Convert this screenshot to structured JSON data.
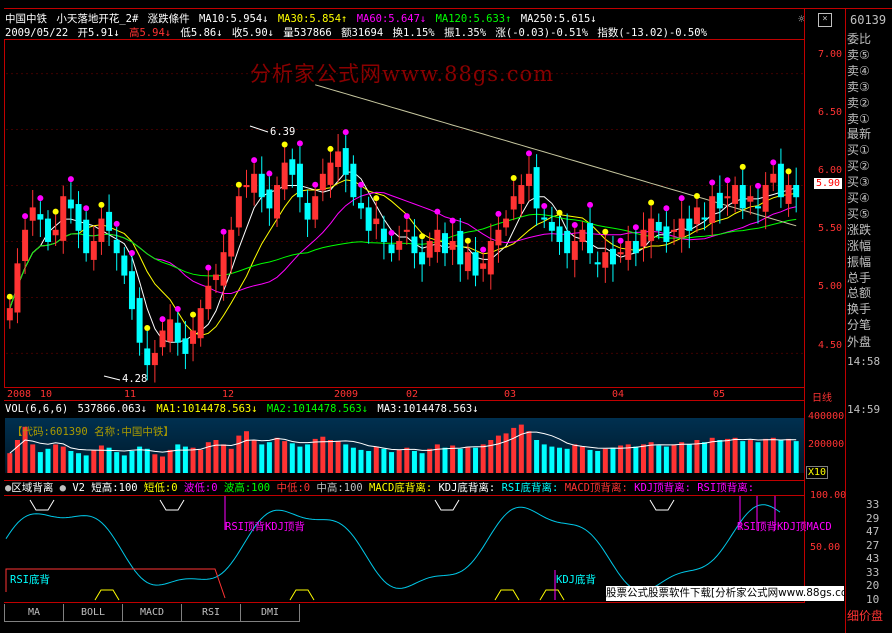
{
  "header": {
    "stock_name": "中国中铁",
    "indicator_name": "小天落地开花_2#",
    "condition": "涨跌條件",
    "ma10": "MA10:5.954↓",
    "ma30": "MA30:5.854↑",
    "ma60": "MA60:5.647↓",
    "ma120": "MA120:5.633↑",
    "ma250": "MA250:5.615↓",
    "date": "2009/05/22",
    "open": "开5.91↓",
    "high": "高5.94↓",
    "low": "低5.86↓",
    "close": "收5.90↓",
    "volume": "量537866",
    "amount": "额31694",
    "turnover": "换1.15%",
    "amplitude": "振1.35%",
    "change": "涨(-0.03)-0.51%",
    "index": "指数(-13.02)-0.50%"
  },
  "watermark": "分析家公式网www.88gs.com",
  "price_axis": [
    "7.00",
    "6.50",
    "6.00",
    "5.50",
    "5.00",
    "4.50"
  ],
  "current_price_badge": "5.90",
  "annot_high": "6.39",
  "annot_low": "4.28",
  "date_axis": [
    "2008",
    "10",
    "11",
    "12",
    "2009",
    "02",
    "03",
    "04",
    "05"
  ],
  "date_axis_right": "日线",
  "volume_header": {
    "vol": "VOL(6,6,6)",
    "value": "537866.063↓",
    "ma1": "MA1:1014478.563↓",
    "ma2": "MA2:1014478.563↓",
    "ma3": "MA3:1014478.563↓"
  },
  "volume_code_label": "【代码:601390 名称:中国中铁】",
  "volume_axis": [
    "400000",
    "200000"
  ],
  "volume_unit": "X10",
  "indicator_header": {
    "name": "区域背离",
    "v2": "V2",
    "items": [
      {
        "text": "短高:100",
        "color": "#ffffff"
      },
      {
        "text": "短低:0",
        "color": "#ffff00"
      },
      {
        "text": "波低:0",
        "color": "#ff00ff"
      },
      {
        "text": "波高:100",
        "color": "#00ff00"
      },
      {
        "text": "中低:0",
        "color": "#ff3333"
      },
      {
        "text": "中高:100",
        "color": "#c0c0c0"
      },
      {
        "text": "MACD底背离:",
        "color": "#ffff00"
      },
      {
        "text": "KDJ底背离:",
        "color": "#ffffff"
      },
      {
        "text": "RSI底背离:",
        "color": "#00ffff"
      },
      {
        "text": "MACD顶背离:",
        "color": "#ff3333"
      },
      {
        "text": "KDJ顶背离:",
        "color": "#ff00ff"
      },
      {
        "text": "RSI顶背离:",
        "color": "#ff00ff"
      }
    ]
  },
  "indicator_axis": [
    "100.00",
    "50.00"
  ],
  "indicator_labels": {
    "rsi_top": "RSI顶背",
    "kdj_top": "KDJ顶背",
    "rsi_bottom": "RSI底背",
    "kdj_bottom": "KDJ底背",
    "rsi_top2": "RSI顶背",
    "kdj_top2": "KDJ顶",
    "macd_top2": "MACD"
  },
  "tabs": [
    "MA",
    "BOLL",
    "MACD",
    "RSI",
    "DMI"
  ],
  "ad_text": "股票公式股票软件下载[分析家公式网www.88gs.com]",
  "sidebar": {
    "code": "60139",
    "rows": [
      "委比",
      "卖⑤",
      "卖④",
      "卖③",
      "卖②",
      "卖①",
      "最新",
      "买①",
      "买②",
      "买③",
      "买④",
      "买⑤",
      "涨跌",
      "涨幅",
      "振幅",
      "总手",
      "总额",
      "换手",
      "分笔"
    ],
    "outer": "外盘",
    "times": [
      "14:58",
      "14:59"
    ],
    "numbers": [
      "33",
      "29",
      "47",
      "27",
      "43",
      "33",
      "20",
      "10"
    ],
    "detail": "细价盘"
  },
  "chart_data": {
    "type": "candlestick",
    "title": "中国中铁",
    "ylim": [
      4.2,
      7.3
    ],
    "y_ticks": [
      4.5,
      5.0,
      5.5,
      6.0,
      6.5,
      7.0
    ],
    "x_labels": [
      "2008",
      "10",
      "11",
      "12",
      "2009",
      "02",
      "03",
      "04",
      "05"
    ],
    "annotations": [
      {
        "label": "6.39",
        "value": 6.39
      },
      {
        "label": "4.28",
        "value": 4.28
      }
    ],
    "last_close": 5.9,
    "closes": [
      4.9,
      5.3,
      5.6,
      5.8,
      5.7,
      5.5,
      5.6,
      5.9,
      5.8,
      5.6,
      5.4,
      5.5,
      5.7,
      5.6,
      5.4,
      5.2,
      4.9,
      4.6,
      4.4,
      4.5,
      4.7,
      4.8,
      4.6,
      4.5,
      4.7,
      4.9,
      5.1,
      5.2,
      5.4,
      5.6,
      5.9,
      6.0,
      6.1,
      5.9,
      5.8,
      6.0,
      6.2,
      6.1,
      5.9,
      5.7,
      5.9,
      6.1,
      6.2,
      6.3,
      6.1,
      5.9,
      5.8,
      5.6,
      5.7,
      5.5,
      5.4,
      5.5,
      5.6,
      5.4,
      5.3,
      5.5,
      5.6,
      5.4,
      5.5,
      5.3,
      5.4,
      5.2,
      5.3,
      5.5,
      5.6,
      5.7,
      5.9,
      6.0,
      6.1,
      5.8,
      5.7,
      5.6,
      5.5,
      5.4,
      5.5,
      5.6,
      5.4,
      5.3,
      5.4,
      5.3,
      5.4,
      5.5,
      5.4,
      5.6,
      5.7,
      5.6,
      5.5,
      5.6,
      5.7,
      5.6,
      5.8,
      5.7,
      5.9,
      5.8,
      5.9,
      6.0,
      5.8,
      5.9,
      5.8,
      6.0,
      6.1,
      5.9,
      6.0,
      5.9
    ],
    "volume": [
      180,
      300,
      420,
      260,
      190,
      220,
      260,
      240,
      200,
      180,
      160,
      210,
      250,
      230,
      190,
      160,
      200,
      240,
      220,
      170,
      150,
      210,
      260,
      240,
      230,
      210,
      280,
      300,
      260,
      220,
      340,
      380,
      300,
      260,
      280,
      320,
      290,
      270,
      240,
      260,
      310,
      330,
      300,
      290,
      260,
      230,
      210,
      200,
      240,
      220,
      190,
      210,
      230,
      200,
      180,
      220,
      260,
      230,
      250,
      220,
      240,
      230,
      260,
      300,
      340,
      360,
      410,
      440,
      380,
      300,
      260,
      240,
      230,
      220,
      260,
      240,
      210,
      200,
      220,
      230,
      250,
      260,
      240,
      260,
      280,
      250,
      240,
      260,
      280,
      260,
      300,
      280,
      320,
      300,
      310,
      320,
      290,
      300,
      280,
      310,
      320,
      300,
      310,
      290
    ]
  }
}
